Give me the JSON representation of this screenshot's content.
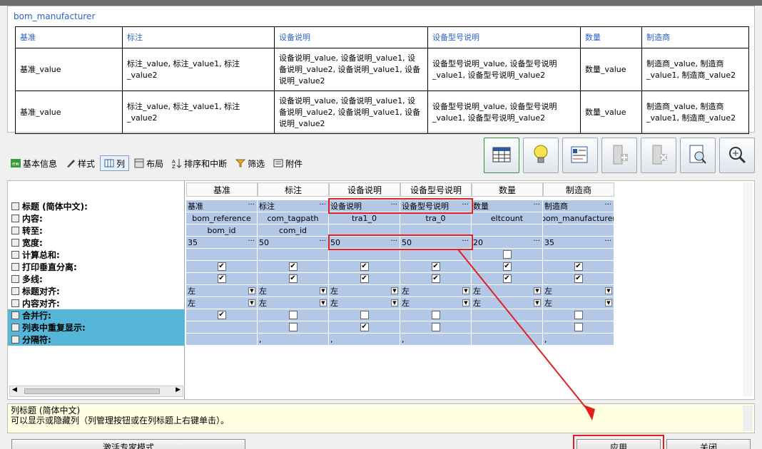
{
  "preview": {
    "title": "bom_manufacturer",
    "headers": [
      "基准",
      "标注",
      "设备说明",
      "设备型号说明",
      "数量",
      "制造商"
    ],
    "rows": [
      [
        "基准_value",
        "标注_value, 标注_value1, 标注_value2",
        "设备说明_value, 设备说明_value1, 设备说明_value2, 设备说明_value1, 设备说明_value2",
        "设备型号说明_value, 设备型号说明_value1, 设备型号说明_value2",
        "数量_value",
        "制造商_value, 制造商_value1, 制造商_value2"
      ],
      [
        "基准_value",
        "标注_value, 标注_value1, 标注_value2",
        "设备说明_value, 设备说明_value1, 设备说明_value2, 设备说明_value1, 设备说明_value2",
        "设备型号说明_value, 设备型号说明_value1, 设备型号说明_value2",
        "数量_value",
        "制造商_value, 制造商_value1, 制造商_value2"
      ]
    ]
  },
  "tabs": [
    {
      "label": "基本信息",
      "icon": "basic-info-icon"
    },
    {
      "label": "样式",
      "icon": "brush-icon"
    },
    {
      "label": "列",
      "icon": "columns-icon",
      "active": true
    },
    {
      "label": "布局",
      "icon": "layout-icon"
    },
    {
      "label": "排序和中断",
      "icon": "sort-icon"
    },
    {
      "label": "筛选",
      "icon": "filter-icon"
    },
    {
      "label": "附件",
      "icon": "attachment-icon"
    }
  ],
  "toolbar": [
    "table-icon",
    "lightbulb-icon",
    "properties-icon",
    "add-column-icon",
    "delete-column-icon",
    "preview-icon",
    "zoom-icon"
  ],
  "grid": {
    "row_labels": [
      "标题 (简体中文):",
      "内容:",
      "转至:",
      "宽度:",
      "计算总和:",
      "打印垂直分离:",
      "多线:",
      "标题对齐:",
      "内容对齐:",
      "合并行:",
      "列表中重复显示:",
      "分隔符:"
    ],
    "columns": [
      {
        "header": "基准",
        "title": "基准",
        "content": "bom_reference",
        "goto": "bom_id",
        "width": "35",
        "sum": null,
        "vsep": true,
        "multiline": true,
        "title_align": "左",
        "content_align": "左",
        "merge": true,
        "repeat": null,
        "sep": ""
      },
      {
        "header": "标注",
        "title": "标注",
        "content": "com_tagpath",
        "goto": "com_id",
        "width": "50",
        "sum": null,
        "vsep": true,
        "multiline": true,
        "title_align": "左",
        "content_align": "左",
        "merge": false,
        "repeat": false,
        "sep": ","
      },
      {
        "header": "设备说明",
        "title": "设备说明",
        "content": "tra1_0",
        "goto": "",
        "width": "50",
        "sum": null,
        "vsep": true,
        "multiline": true,
        "title_align": "左",
        "content_align": "左",
        "merge": false,
        "repeat": true,
        "sep": ","
      },
      {
        "header": "设备型号说明",
        "title": "设备型号说明",
        "content": "tra_0",
        "goto": "",
        "width": "50",
        "sum": null,
        "vsep": true,
        "multiline": true,
        "title_align": "左",
        "content_align": "左",
        "merge": false,
        "repeat": false,
        "sep": ","
      },
      {
        "header": "数量",
        "title": "数量",
        "content": "eltcount",
        "goto": "",
        "width": "20",
        "sum": false,
        "vsep": true,
        "multiline": true,
        "title_align": "左",
        "content_align": "左",
        "merge": null,
        "repeat": null,
        "sep": ""
      },
      {
        "header": "制造商",
        "title": "制造商",
        "content": "bom_manufacturer",
        "goto": "",
        "width": "35",
        "sum": null,
        "vsep": true,
        "multiline": true,
        "title_align": "左",
        "content_align": "左",
        "merge": false,
        "repeat": false,
        "sep": ","
      }
    ]
  },
  "help": {
    "line1": "列标题 (简体中文)",
    "line2": "可以显示或隐藏列（列管理按钮或在列标题上右键单击）。"
  },
  "buttons": {
    "expert": "激活专家模式",
    "apply": "应用",
    "close": "关闭"
  },
  "colors": {
    "cell": "#b3c7e7",
    "highlight": "#e02020",
    "blue_row": "#56b6d8",
    "title_blue": "#2962c6"
  }
}
